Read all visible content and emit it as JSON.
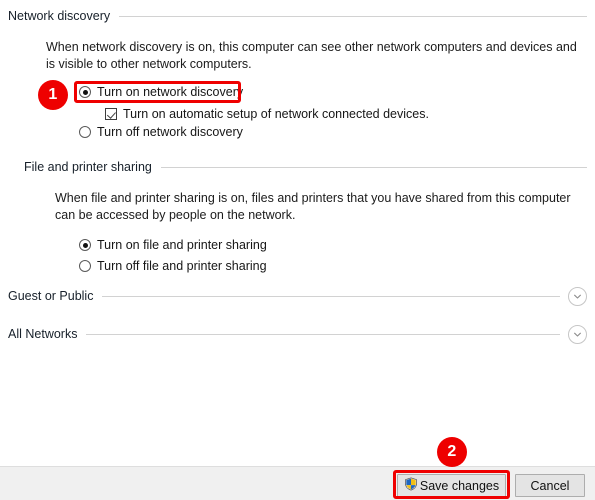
{
  "sections": [
    {
      "id": "network-discovery",
      "title": "Network discovery",
      "description": "When network discovery is on, this computer can see other network computers and devices and is visible to other network computers.",
      "options": [
        {
          "id": "turn-on-network-discovery",
          "type": "radio",
          "label": "Turn on network discovery",
          "checked": true,
          "highlighted": true
        },
        {
          "id": "turn-on-automatic-setup",
          "type": "checkbox",
          "label": "Turn on automatic setup of network connected devices.",
          "checked": true,
          "highlighted": false
        },
        {
          "id": "turn-off-network-discovery",
          "type": "radio",
          "label": "Turn off network discovery",
          "checked": false,
          "highlighted": false
        }
      ]
    },
    {
      "id": "file-and-printer-sharing",
      "title": "File and printer sharing",
      "description": "When file and printer sharing is on, files and printers that you have shared from this computer can be accessed by people on the network.",
      "options": [
        {
          "id": "turn-on-file-and-printer-sharing",
          "type": "radio",
          "label": "Turn on file and printer sharing",
          "checked": true,
          "highlighted": false
        },
        {
          "id": "turn-off-file-and-printer-sharing",
          "type": "radio",
          "label": "Turn off file and printer sharing",
          "checked": false,
          "highlighted": false
        }
      ]
    }
  ],
  "collapsed_sections": [
    {
      "id": "guest-or-public",
      "title": "Guest or Public",
      "expand_icon": "chevron-down-icon"
    },
    {
      "id": "all-networks",
      "title": "All Networks",
      "expand_icon": "chevron-down-icon"
    }
  ],
  "footer": {
    "save_button": {
      "label": "Save changes",
      "icon": "uac-shield-icon",
      "highlighted": true
    },
    "cancel_button": {
      "label": "Cancel"
    }
  },
  "annotations": {
    "accent_color": "#ee0000",
    "badges": [
      {
        "id": "step-1",
        "label": "1",
        "target": "turn-on-network-discovery"
      },
      {
        "id": "step-2",
        "label": "2",
        "target": "save-changes-button"
      }
    ]
  }
}
